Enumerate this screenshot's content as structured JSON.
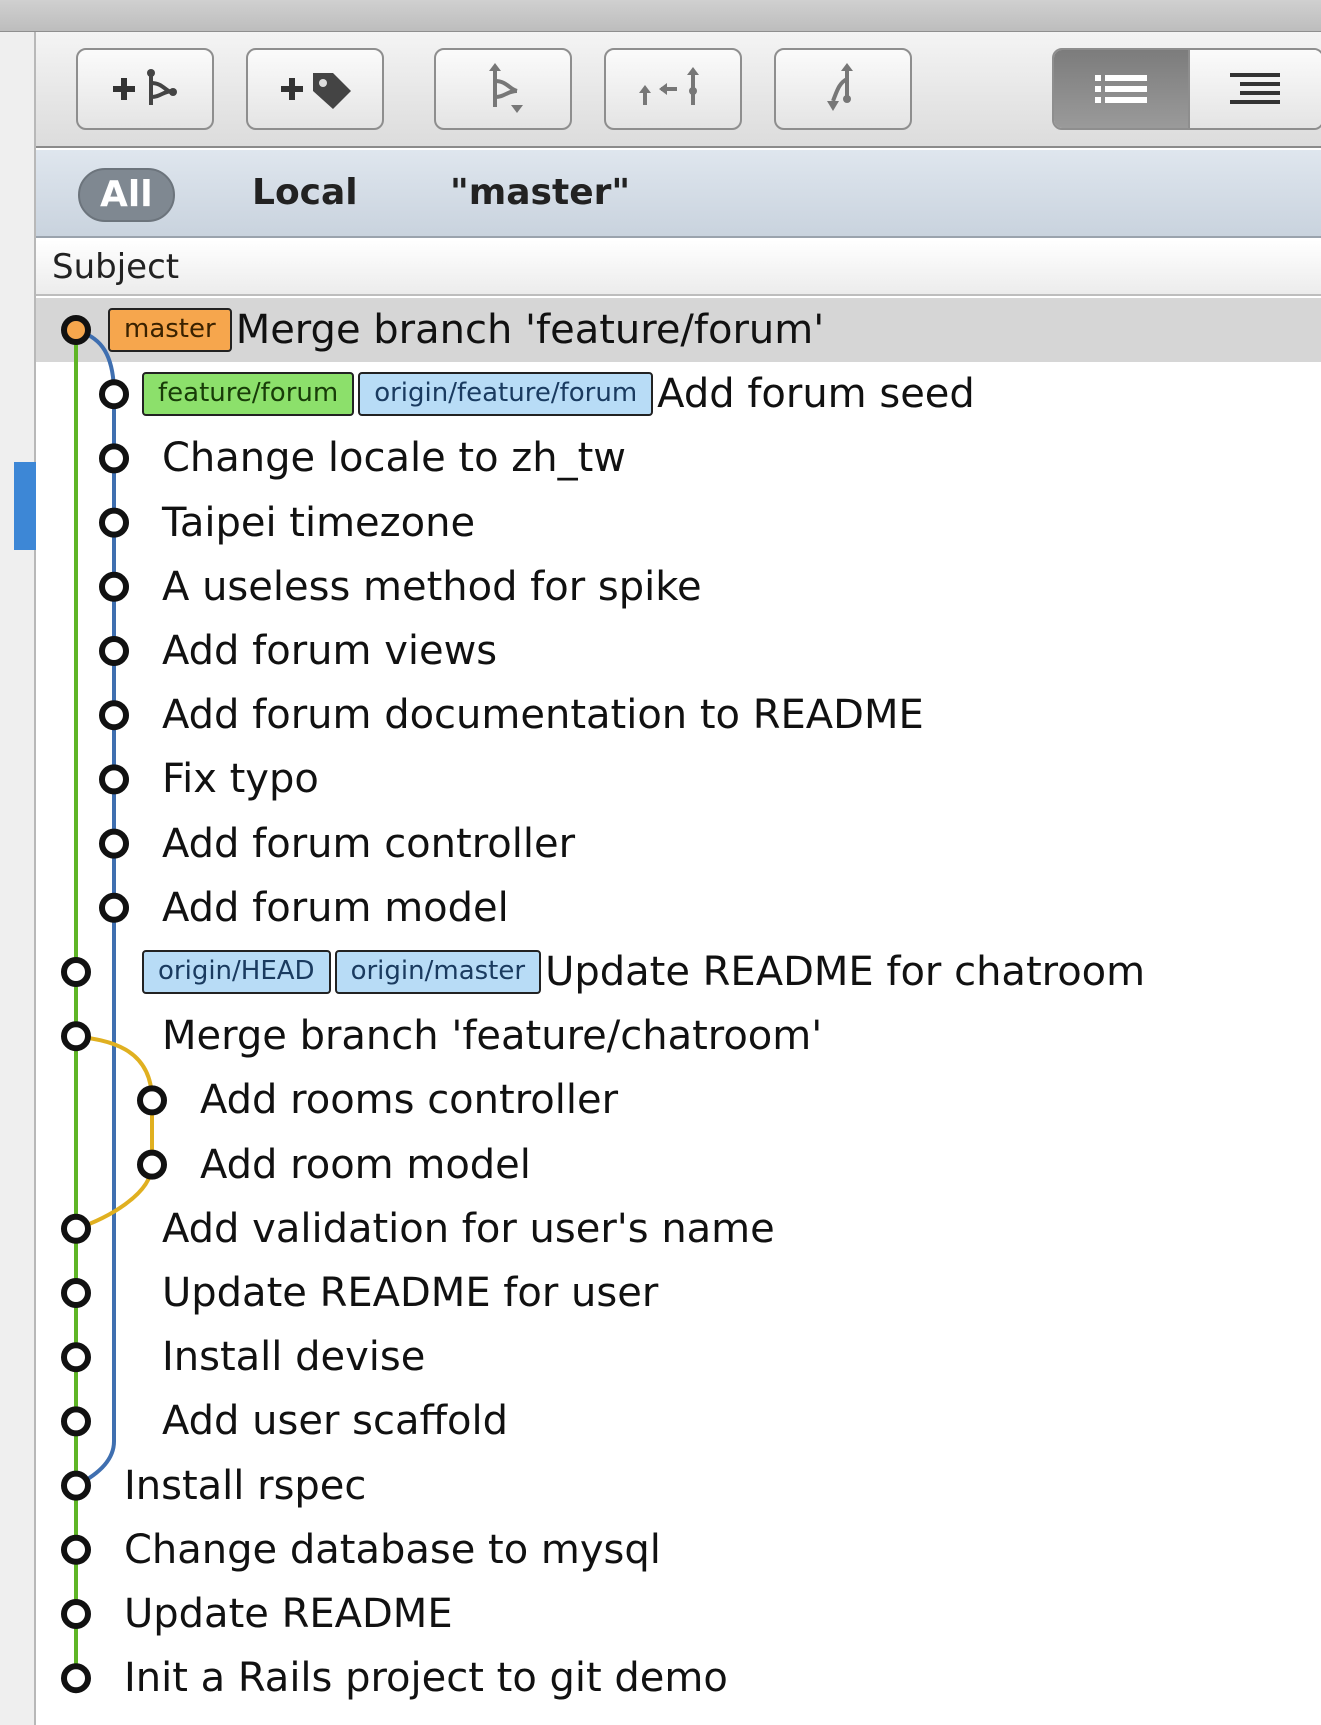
{
  "toolbar": {
    "buttons": [
      {
        "icon": "add-branch-icon"
      },
      {
        "icon": "add-tag-icon"
      },
      {
        "icon": "checkout-icon"
      },
      {
        "icon": "merge-icon"
      },
      {
        "icon": "rebase-icon"
      }
    ],
    "view_toggle": [
      {
        "icon": "list-view-icon",
        "active": true
      },
      {
        "icon": "tree-view-icon",
        "active": false
      }
    ]
  },
  "filters": {
    "all": "All",
    "local": "Local",
    "master": "\"master\""
  },
  "header": {
    "subject": "Subject"
  },
  "colors": {
    "green_line": "#5fb526",
    "blue_line": "#3f6fb0",
    "yellow_line": "#e0b020",
    "master_tag": "#f6a64d",
    "feature_tag": "#8ce06b",
    "remote_tag": "#b8dcf6"
  },
  "commits": [
    {
      "subject": "Merge branch 'feature/forum'",
      "tags": [
        {
          "label": "master",
          "kind": "local-master"
        }
      ]
    },
    {
      "subject": "Add forum seed",
      "tags": [
        {
          "label": "feature/forum",
          "kind": "local-feature"
        },
        {
          "label": "origin/feature/forum",
          "kind": "remote"
        }
      ]
    },
    {
      "subject": "Change locale to zh_tw",
      "tags": []
    },
    {
      "subject": "Taipei timezone",
      "tags": []
    },
    {
      "subject": "A useless method for spike",
      "tags": []
    },
    {
      "subject": "Add forum views",
      "tags": []
    },
    {
      "subject": "Add forum documentation to README",
      "tags": []
    },
    {
      "subject": "Fix typo",
      "tags": []
    },
    {
      "subject": "Add forum controller",
      "tags": []
    },
    {
      "subject": "Add forum model",
      "tags": []
    },
    {
      "subject": "Update README for chatroom",
      "tags": [
        {
          "label": "origin/HEAD",
          "kind": "remote"
        },
        {
          "label": "origin/master",
          "kind": "remote"
        }
      ]
    },
    {
      "subject": "Merge branch 'feature/chatroom'",
      "tags": []
    },
    {
      "subject": "Add rooms controller",
      "tags": []
    },
    {
      "subject": "Add room model",
      "tags": []
    },
    {
      "subject": "Add validation for user's name",
      "tags": []
    },
    {
      "subject": "Update README for user",
      "tags": []
    },
    {
      "subject": "Install devise",
      "tags": []
    },
    {
      "subject": "Add user scaffold",
      "tags": []
    },
    {
      "subject": "Install rspec",
      "tags": []
    },
    {
      "subject": "Change database to mysql",
      "tags": []
    },
    {
      "subject": "Update README",
      "tags": []
    },
    {
      "subject": "Init a Rails project to git demo",
      "tags": []
    }
  ]
}
